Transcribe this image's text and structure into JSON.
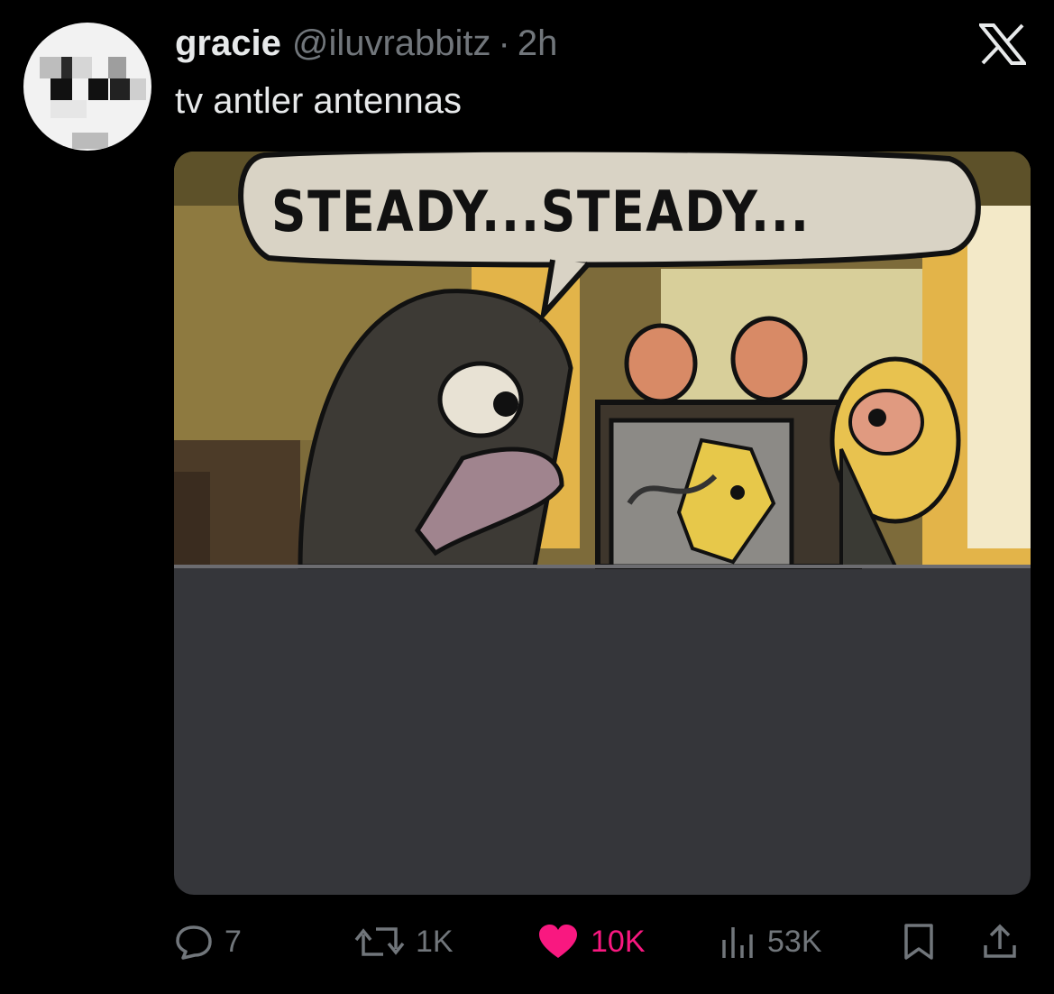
{
  "tweet": {
    "display_name": "gracie",
    "handle": "@iluvrabbitz",
    "separator": "·",
    "time": "2h",
    "text": "tv antler antennas"
  },
  "media": {
    "speech_bubble_text": "STEADY...STEADY..."
  },
  "actions": {
    "replies": "7",
    "reposts": "1K",
    "likes": "10K",
    "views": "53K"
  },
  "icons": {
    "logo": "x-logo-icon",
    "reply": "comment-icon",
    "repost": "repost-icon",
    "like": "heart-icon",
    "views": "bar-chart-icon",
    "bookmark": "bookmark-icon",
    "share": "share-icon"
  },
  "colors": {
    "background": "#000000",
    "text_primary": "#e7e9ea",
    "text_secondary": "#71767b",
    "like_active": "#f91880",
    "media_placeholder": "#35363a"
  }
}
